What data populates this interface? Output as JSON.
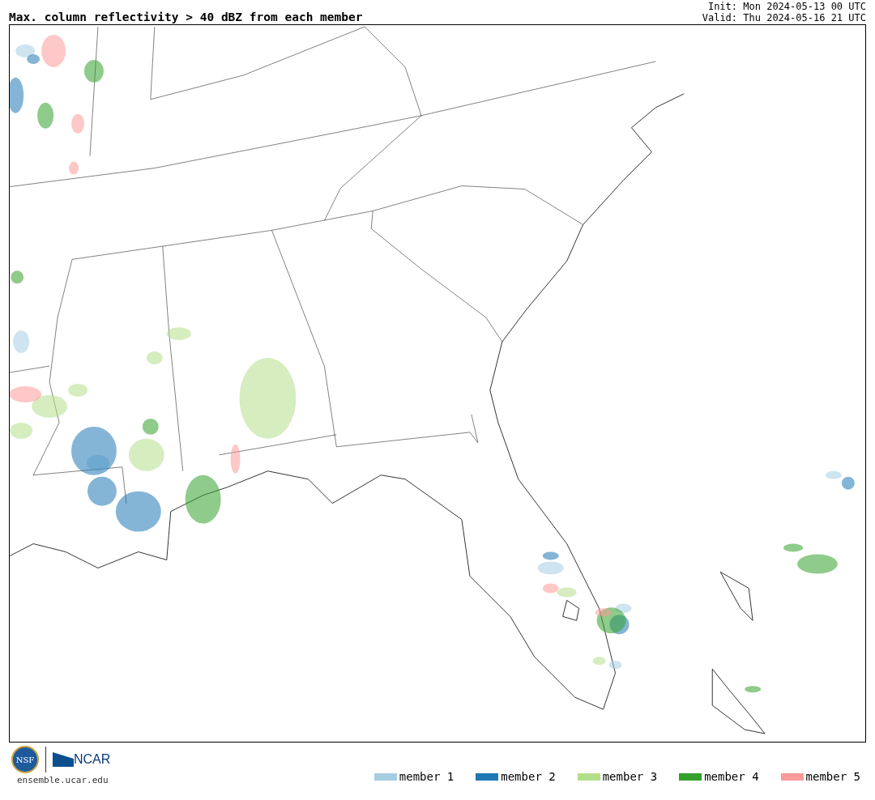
{
  "title": "Max. column reflectivity > 40 dBZ from each member",
  "init": "Init: Mon 2024-05-13 00 UTC",
  "valid": "Valid: Thu 2024-05-16 21 UTC",
  "logos": {
    "nsf": "NSF",
    "ncar": "NCAR",
    "site": "ensemble.ucar.edu"
  },
  "legend": [
    {
      "label": "member 1",
      "color": "#a6cee3"
    },
    {
      "label": "member 2",
      "color": "#1f78b4"
    },
    {
      "label": "member 3",
      "color": "#b2df8a"
    },
    {
      "label": "member 4",
      "color": "#33a02c"
    },
    {
      "label": "member 5",
      "color": "#fb9a99"
    }
  ]
}
